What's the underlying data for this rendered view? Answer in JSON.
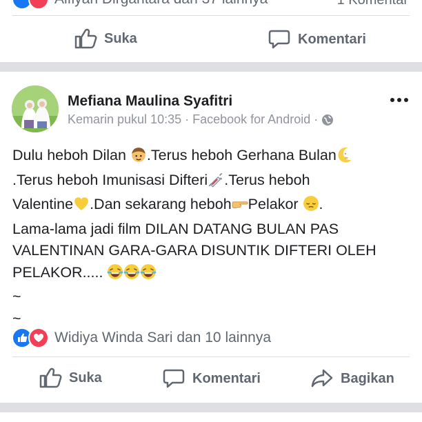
{
  "top_post": {
    "reactions_text": "Alfiyan Dirgantara dan 37 lainnya",
    "comment_count": "1 Komentar",
    "actions": {
      "like": "Suka",
      "comment": "Komentari"
    }
  },
  "post": {
    "author": "Mefiana Maulina Syafitri",
    "timestamp": "Kemarin pukul 10:35",
    "separator": "·",
    "source": "Facebook for Android",
    "privacy_icon": "globe-icon",
    "more_icon": "more-options-icon",
    "body_lines": [
      [
        "Dulu heboh Dilan ",
        {
          "emoji": "boy-face"
        },
        ".Terus heboh Gerhana Bulan",
        {
          "emoji": "crescent-moon"
        }
      ],
      [
        ".Terus heboh Imunisasi Difteri",
        {
          "emoji": "syringe"
        },
        ".Terus heboh"
      ],
      [
        "Valentine",
        {
          "emoji": "yellow-heart"
        },
        ".Dan sekarang heboh",
        {
          "emoji": "pointing-hand"
        },
        "Pelakor ",
        {
          "emoji": "pensive-face"
        },
        "."
      ],
      [
        "Lama-lama jadi film DILAN DATANG BULAN PAS"
      ],
      [
        "VALENTINAN GARA-GARA DISUNTIK DIFTERI OLEH"
      ],
      [
        "PELAKOR..... ",
        {
          "emoji": "laughing-face"
        },
        {
          "emoji": "laughing-face"
        },
        {
          "emoji": "laughing-face"
        }
      ],
      [
        "~"
      ],
      [
        "~"
      ]
    ],
    "reactions_text": "Widiya Winda Sari dan 10 lainnya",
    "actions": {
      "like": "Suka",
      "comment": "Komentari",
      "share": "Bagikan"
    }
  },
  "colors": {
    "facebook_blue": "#1877f2",
    "love_red": "#f33e58",
    "muted_text": "#606770",
    "meta_text": "#90949c"
  }
}
